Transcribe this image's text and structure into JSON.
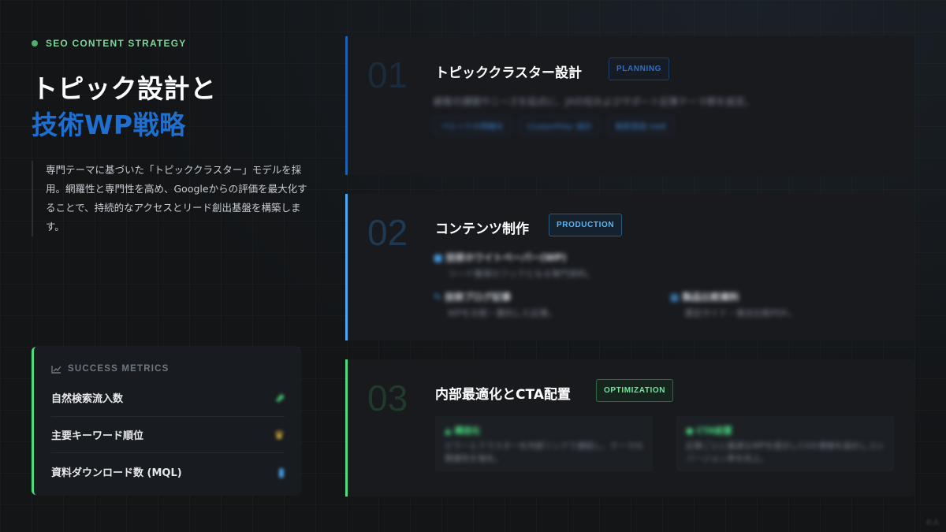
{
  "left": {
    "kicker": "SEO CONTENT STRATEGY",
    "title_line1": "トピック設計と",
    "title_line2": "技術WP戦略",
    "description": "専門テーマに基づいた「トピッククラスター」モデルを採用。網羅性と専門性を高め、Googleからの評価を最大化することで、持続的なアクセスとリード創出基盤を構築します。"
  },
  "metrics": {
    "heading": "SUCCESS METRICS",
    "heading_icon": "chart-icon",
    "items": [
      {
        "label": "自然検索流入数",
        "icon": "trend-up-icon",
        "color": "#4ade80"
      },
      {
        "label": "主要キーワード順位",
        "icon": "crown-icon",
        "color": "#f5c542"
      },
      {
        "label": "資料ダウンロード数 (MQL)",
        "icon": "file-download-icon",
        "color": "#4aa8f5"
      }
    ]
  },
  "cards": [
    {
      "num": "01",
      "title": "トピッククラスター設計",
      "tag": "PLANNING",
      "accent": "#1f5fb0",
      "body": "顧客の課題やニーズを起点に、JAの柱およびサポート記事テーマ群を設定。",
      "chips": [
        "ペルソナの明確化",
        "ClusterPillar 設計",
        "検索意図 SWE"
      ]
    },
    {
      "num": "02",
      "title": "コンテンツ制作",
      "tag": "PRODUCTION",
      "accent": "#4aa8f5",
      "items": [
        {
          "title": "技術ホワイトペーパー(WP)",
          "desc": "リード獲得のフックとなる専門資料。"
        },
        {
          "title": "技術ブログ記事",
          "desc": "WPを分割・要約した記事。"
        },
        {
          "title": "製品比較資料",
          "desc": "選定ガイド・競合比較PDF。"
        }
      ]
    },
    {
      "num": "03",
      "title": "内部最適化とCTA配置",
      "tag": "OPTIMIZATION",
      "accent": "#4ade80",
      "boxes": [
        {
          "title": "構造化",
          "desc": "ピラーとクラスターを内部リンクで連結し、テーマの関連性を強化。"
        },
        {
          "title": "CTA設置",
          "desc": "記事ごとに最適なWPを提示しCVの導線を設計しコンバージョン率を向上。"
        }
      ]
    }
  ],
  "watermark": "©人"
}
